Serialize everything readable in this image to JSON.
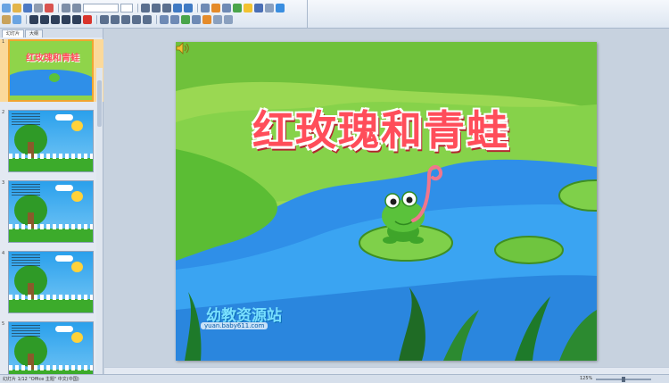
{
  "panel": {
    "tabs": [
      "幻灯片",
      "大纲"
    ],
    "slide_numbers": [
      "1",
      "2",
      "3",
      "4",
      "5"
    ],
    "thumb_title": "红玫瑰和青蛙"
  },
  "slide": {
    "title": "红玫瑰和青蛙",
    "watermark_cn": "幼教资源站",
    "watermark_url": "yuan.baby611.com"
  },
  "status": {
    "left": "幻灯片 1/12   \"Office 主题\"   中文(中国)",
    "zoom": "125%"
  },
  "colors": {
    "title": "#ff4d5a",
    "grass": "#8fd44a",
    "water": "#2f8fe8",
    "frog": "#5ac23b",
    "selection": "#f0a530"
  },
  "icons": [
    "new-icon",
    "open-icon",
    "save-icon",
    "print-icon",
    "bold-icon",
    "italic-icon",
    "underline-icon",
    "align-icon",
    "speaker-icon"
  ]
}
